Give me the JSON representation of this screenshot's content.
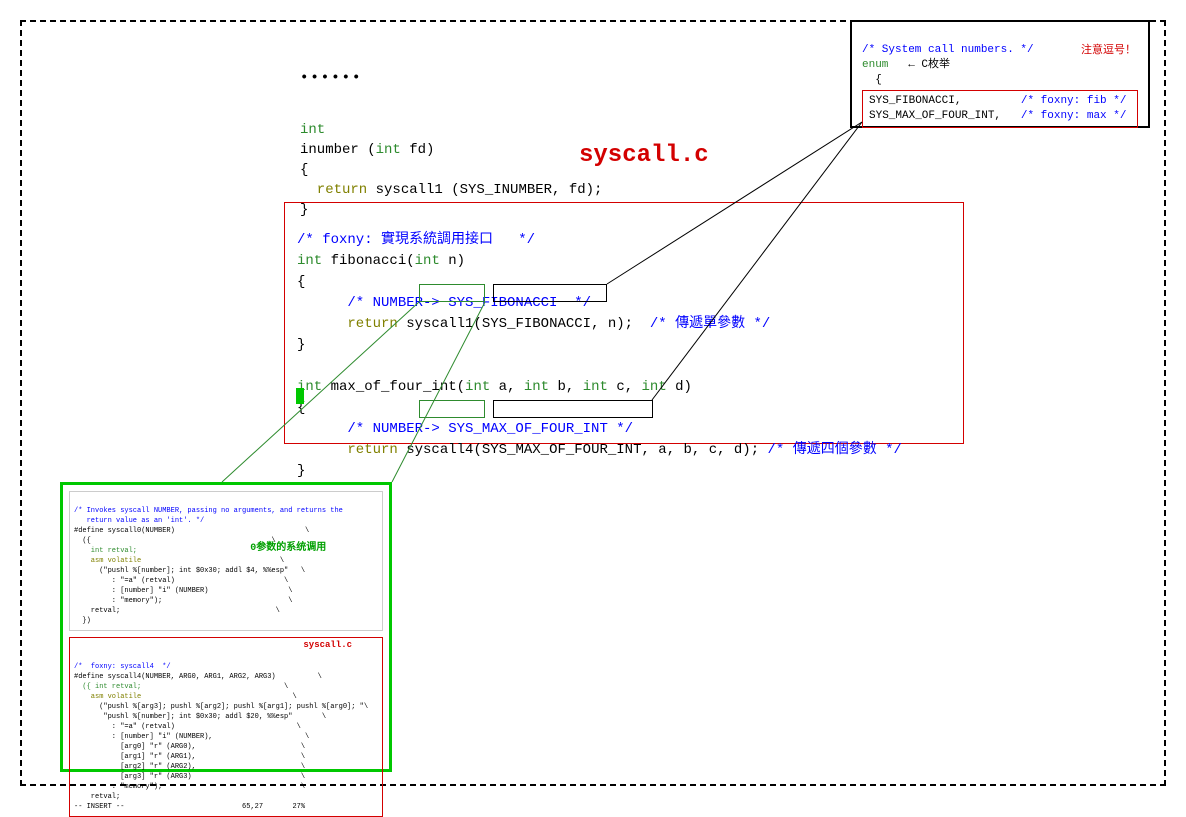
{
  "dots": "••••••",
  "title": "syscall.c",
  "top_code": {
    "l1": "int",
    "l2": "inumber (",
    "l2_kw": "int",
    "l2_rest": " fd)",
    "l3": "{",
    "l4_kw": "  return",
    "l4_rest": " syscall1 (SYS_INUMBER, fd);",
    "l5": "}"
  },
  "red": {
    "c1": "/* foxny: 實現系統調用接口   */",
    "f1_a": "int",
    "f1_b": " fibonacci(",
    "f1_c": "int",
    "f1_d": " n)",
    "lb": "{",
    "c2": "      /* NUMBER-> SYS_FIBONACCI  */",
    "r1_kw": "      return",
    "r1_fn": " syscall1",
    "r1_paren": "(",
    "r1_const": "SYS_FIBONACCI",
    "r1_rest": ", n);  ",
    "r1_cmt": "/* 傳遞單參數 */",
    "rb": "}",
    "f2_a": "int",
    "f2_b": " max_of_four_int(",
    "f2_c": "int",
    "f2_d": " a, ",
    "f2_e": "int",
    "f2_f": " b, ",
    "f2_g": "int",
    "f2_h": " c, ",
    "f2_i": "int",
    "f2_j": " d)",
    "c3": "      /* NUMBER-> SYS_MAX_OF_FOUR_INT */",
    "r2_kw": "      return",
    "r2_fn": " syscall4",
    "r2_paren": "(",
    "r2_const": "SYS_MAX_OF_FOUR_INT,",
    "r2_rest": " a, b, c, d); ",
    "r2_cmt": "/* 傳遞四個參數 */"
  },
  "enum": {
    "c1": "/* System call numbers. */",
    "kw": "enum",
    "note1": "   ← C枚举",
    "warn": "注意逗号！",
    "lb": "  {",
    "row1": "SYS_FIBONACCI,",
    "row1c": "/* foxny: fib */",
    "row2": "SYS_MAX_OF_FOUR_INT,",
    "row2c": "/* foxny: max */"
  },
  "thumb": {
    "top": {
      "title": "0参数的系统调用",
      "l1": "/* Invokes syscall NUMBER, passing no arguments, and returns the",
      "l2": "   return value as an 'int'. */",
      "l3": "#define syscall0(NUMBER)",
      "l4": "  ({",
      "l5": "    int retval;",
      "l6": "    asm volatile",
      "l7": "      (\"pushl %[number]; int $0x30; addl $4, %%esp\"",
      "l8": "         : \"=a\" (retval)",
      "l9": "         : [number] \"i\" (NUMBER)",
      "l10": "         : \"memory\");",
      "l11": "    retval;",
      "l12": "  })"
    },
    "bot": {
      "title": "syscall.c",
      "l1": "/*  foxny: syscall4  */",
      "l2": "#define syscall4(NUMBER, ARG0, ARG1, ARG2, ARG3)",
      "l3": "  ({ int retval;",
      "l4": "    asm volatile",
      "l5": "      (\"pushl %[arg3]; pushl %[arg2]; pushl %[arg1]; pushl %[arg0]; \"",
      "l6": "       \"pushl %[number]; int $0x30; addl $20, %%esp\"",
      "l7": "         : \"=a\" (retval)",
      "l8": "         : [number] \"i\" (NUMBER),",
      "l9": "           [arg0] \"r\" (ARG0),",
      "l10": "           [arg1] \"r\" (ARG1),",
      "l11": "           [arg2] \"r\" (ARG2),",
      "l12": "           [arg3] \"r\" (ARG3)",
      "l13": "         : \"memory\");",
      "l14": "    retval;",
      "status": "-- INSERT --",
      "pos": "65,27       27%"
    }
  }
}
